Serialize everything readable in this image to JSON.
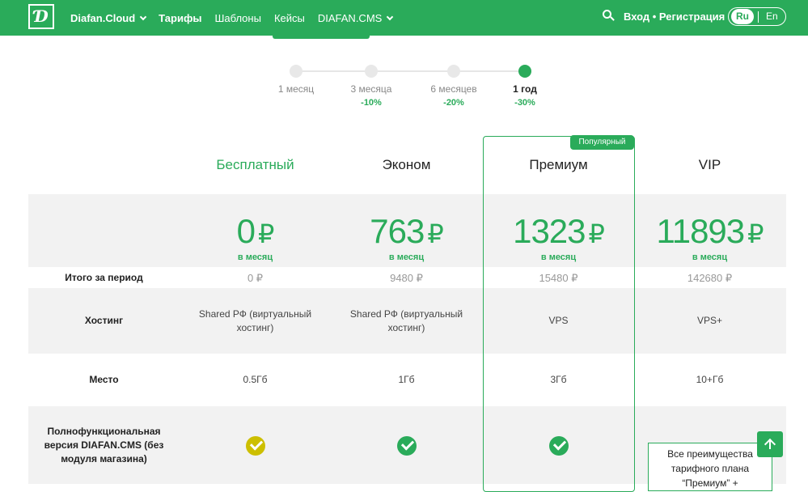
{
  "header": {
    "logo_text": "Ɗ",
    "nav": [
      {
        "label": "Diafan.Cloud",
        "bold": true,
        "dropdown": true
      },
      {
        "label": "Тарифы",
        "bold": true,
        "dropdown": false
      },
      {
        "label": "Шаблоны",
        "bold": false,
        "dropdown": false
      },
      {
        "label": "Кейсы",
        "bold": false,
        "dropdown": false
      },
      {
        "label": "DIAFAN.CMS",
        "bold": false,
        "dropdown": true
      }
    ],
    "auth_label": "Вход • Регистрация",
    "lang_active": "Ru",
    "lang_other": "En",
    "accent_color": "#2aab5a"
  },
  "periods": [
    {
      "label": "1 месяц",
      "discount": "",
      "active": false
    },
    {
      "label": "3 месяца",
      "discount": "-10%",
      "active": false
    },
    {
      "label": "6 месяцев",
      "discount": "-20%",
      "active": false
    },
    {
      "label": "1 год",
      "discount": "-30%",
      "active": true
    }
  ],
  "popular_badge": "Популярный",
  "plans": [
    {
      "name": "Бесплатный",
      "price": "0",
      "currency": "₽",
      "per": "в месяц",
      "total": "0 ₽",
      "hosting": "Shared РФ (виртуальный хостинг)",
      "space": "0.5Гб",
      "feature": "check-yellow"
    },
    {
      "name": "Эконом",
      "price": "763",
      "currency": "₽",
      "per": "в месяц",
      "total": "9480 ₽",
      "hosting": "Shared РФ (виртуальный хостинг)",
      "space": "1Гб",
      "feature": "check"
    },
    {
      "name": "Премиум",
      "price": "1323",
      "currency": "₽",
      "per": "в месяц",
      "total": "15480 ₽",
      "hosting": "VPS",
      "space": "3Гб",
      "feature": "check"
    },
    {
      "name": "VIP",
      "price": "11893",
      "currency": "₽",
      "per": "в месяц",
      "total": "142680 ₽",
      "hosting": "VPS+",
      "space": "10+Гб",
      "feature": "box"
    }
  ],
  "rows": {
    "total": "Итого за период",
    "hosting": "Хостинг",
    "space": "Место",
    "feature": "Полнофункциональная версия DIAFAN.CMS (без модуля магазина)"
  },
  "vip_box_text": "Все преимущества тарифного плана “Премиум” +"
}
